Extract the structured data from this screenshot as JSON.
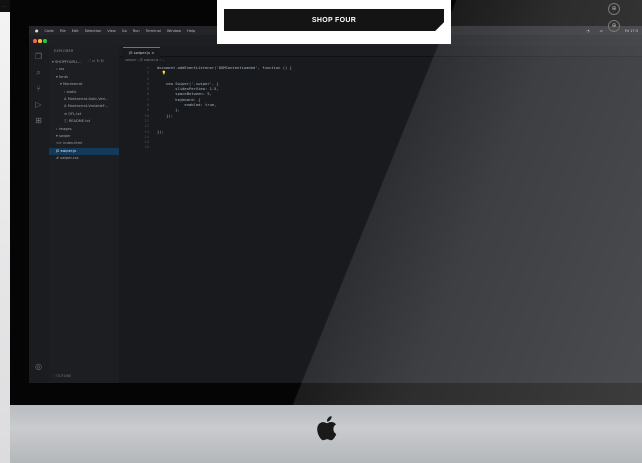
{
  "header": {
    "shop_label": "SHOP FOUR"
  },
  "macos_menu": {
    "items": [
      "Code",
      "File",
      "Edit",
      "Selection",
      "View",
      "Go",
      "Run",
      "Terminal",
      "Window",
      "Help"
    ],
    "status_time": "Fri 17:3"
  },
  "window_title": "swiper.js — tb-frontend",
  "explorer": {
    "heading": "EXPLORER",
    "rows": [
      {
        "label": "▾ SHOPFOUR-L…",
        "indent": 0,
        "selected": false
      },
      {
        "label": "› css",
        "indent": 1,
        "selected": false
      },
      {
        "label": "▾ fonts",
        "indent": 1,
        "selected": false
      },
      {
        "label": "▾ Montserrat",
        "indent": 2,
        "selected": false
      },
      {
        "label": "› static",
        "indent": 3,
        "selected": false
      },
      {
        "label": "A Montserrat-Italic-Vari…",
        "indent": 3,
        "selected": false
      },
      {
        "label": "A Montserrat-VariableF…",
        "indent": 3,
        "selected": false
      },
      {
        "label": "≡ OFL.txt",
        "indent": 3,
        "selected": false
      },
      {
        "label": "ⓘ README.txt",
        "indent": 3,
        "selected": false
      },
      {
        "label": "› images",
        "indent": 1,
        "selected": false
      },
      {
        "label": "▾ swiper",
        "indent": 1,
        "selected": false
      },
      {
        "label": "<> index.html",
        "indent": 1,
        "selected": false
      },
      {
        "label": "JS swiper.js",
        "indent": 1,
        "selected": true
      },
      {
        "label": "# swiper.css",
        "indent": 1,
        "selected": false
      }
    ],
    "outline_label": "› OUTLINE"
  },
  "editor": {
    "tab_label": "JS swiper.js  ×",
    "breadcrumb": "swiper  ›  JS swiper.js  ›  …",
    "lines": [
      "document.addEventListener('DOMContentLoaded', function () {",
      "  💡",
      "",
      "    new Swiper('.swiper', {",
      "        slidesPerView: 1.5,",
      "        spaceBetween: 5,",
      "        keyboard: {",
      "            enabled: true,",
      "        },",
      "    });",
      "",
      "",
      "});",
      "",
      "",
      ""
    ]
  },
  "colors": {
    "accent": "#3b82c4",
    "editor_bg": "#181a1e",
    "selection": "#143a5a"
  },
  "icons": {
    "activity": [
      "files-icon",
      "search-icon",
      "source-control-icon",
      "run-debug-icon",
      "extensions-icon",
      "account-icon"
    ]
  }
}
